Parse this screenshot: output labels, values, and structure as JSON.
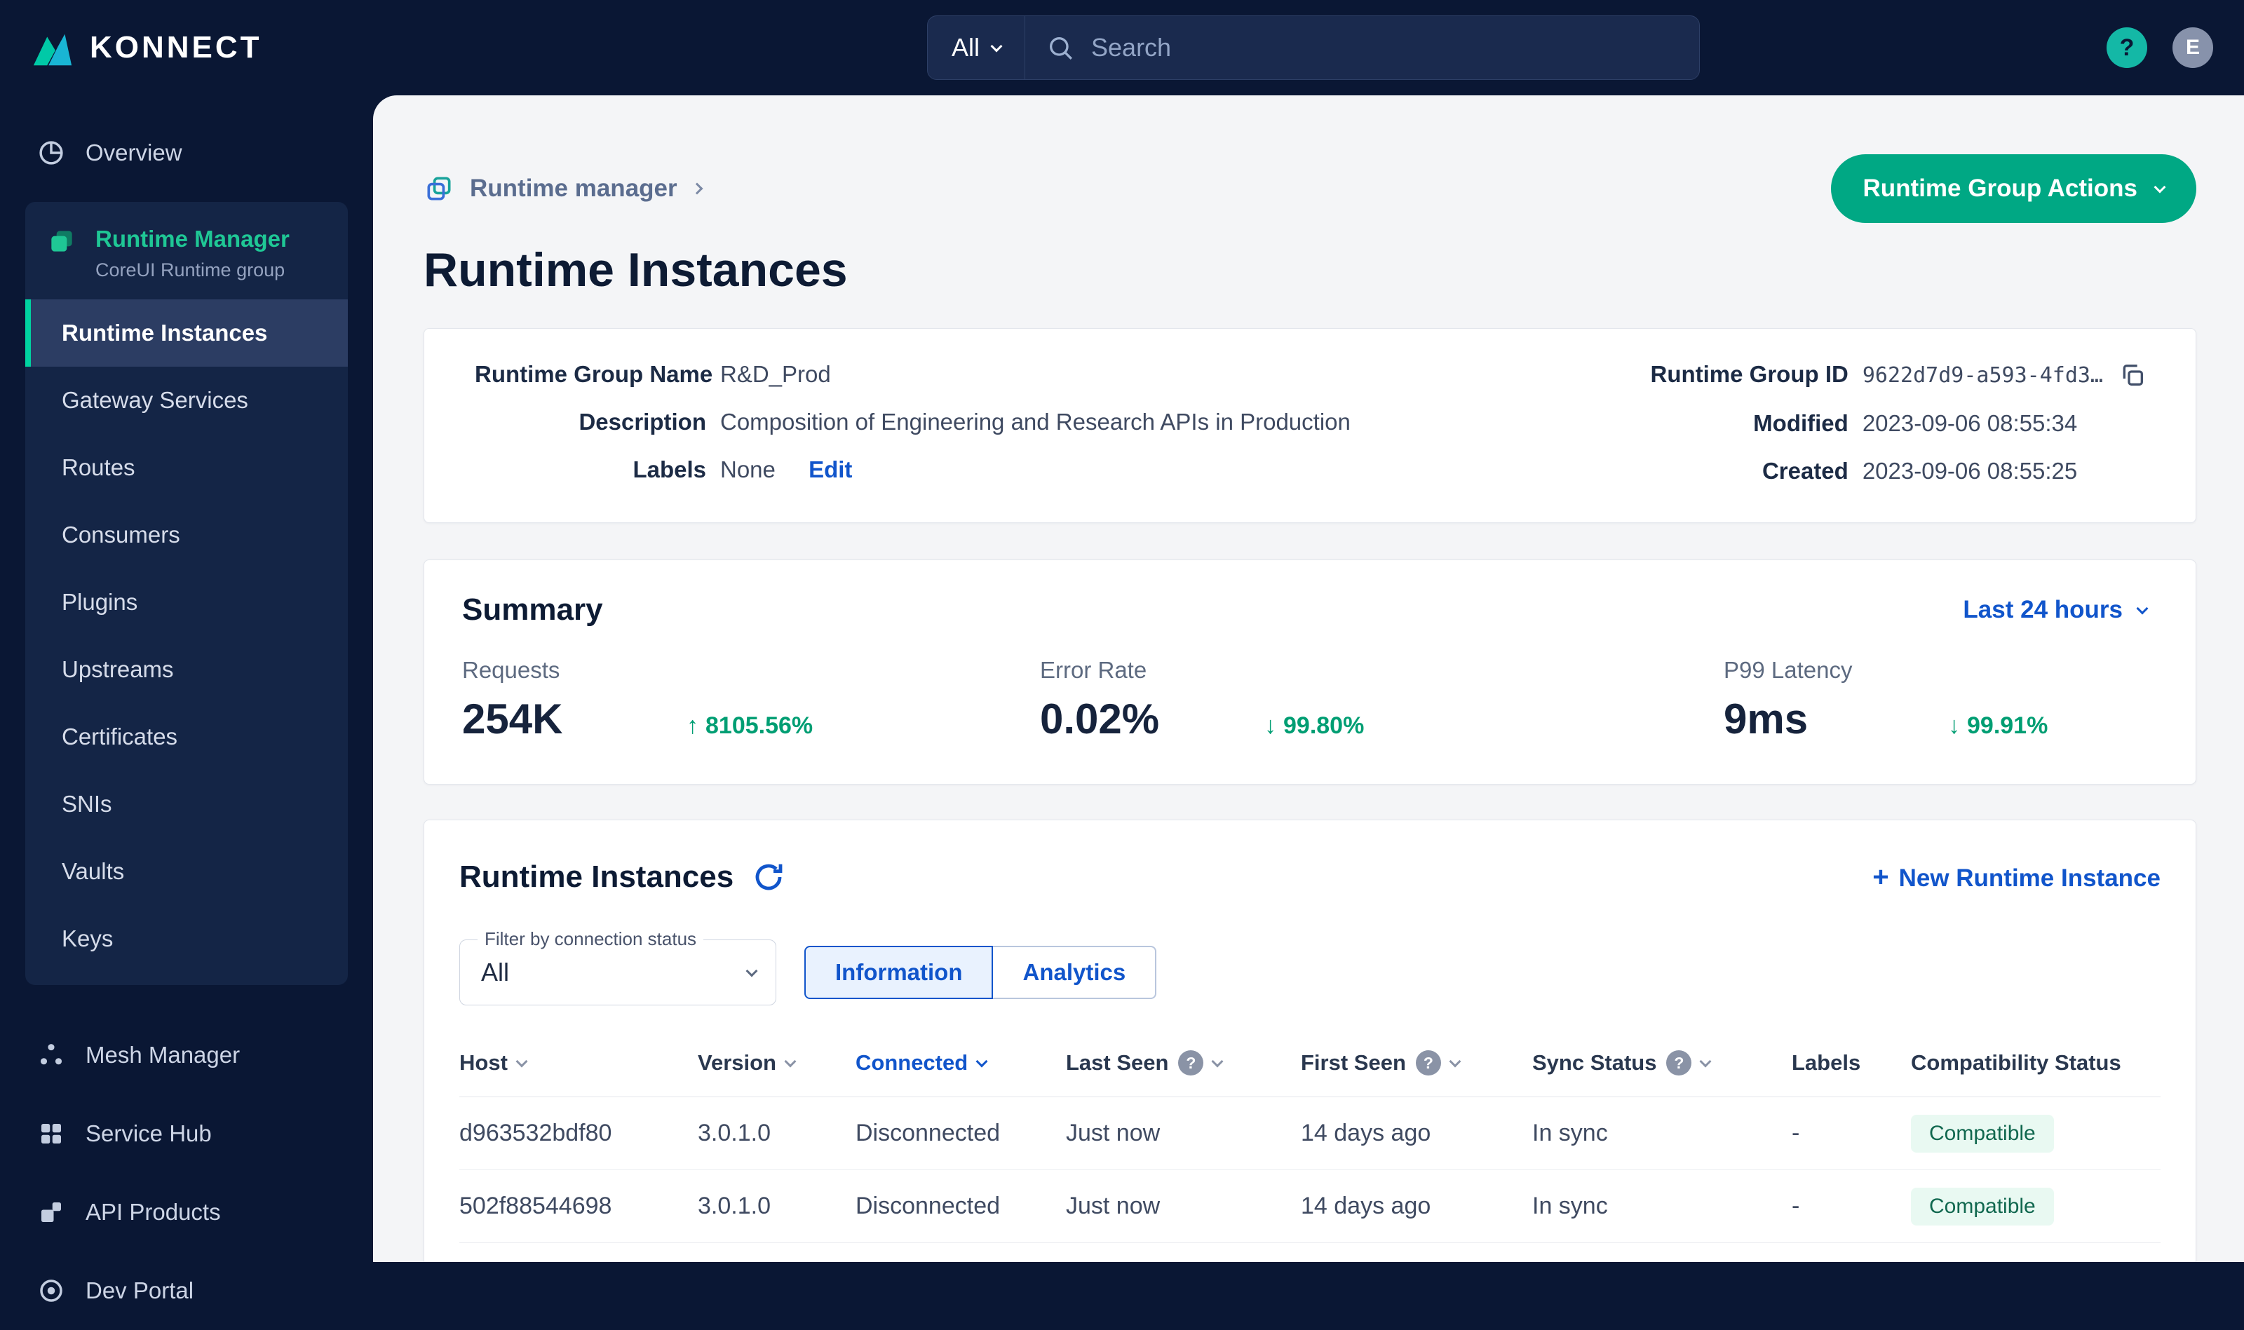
{
  "topbar": {
    "logo": "KONNECT",
    "search": {
      "scope": "All",
      "placeholder": "Search"
    },
    "avatar_initial": "E",
    "help_glyph": "?"
  },
  "sidebar": {
    "overview_label": "Overview",
    "group": {
      "title": "Runtime Manager",
      "subtitle": "CoreUI Runtime group",
      "items": [
        "Runtime Instances",
        "Gateway Services",
        "Routes",
        "Consumers",
        "Plugins",
        "Upstreams",
        "Certificates",
        "SNIs",
        "Vaults",
        "Keys"
      ],
      "active_item": "Runtime Instances"
    },
    "bottom_items": [
      "Mesh Manager",
      "Service Hub",
      "API Products",
      "Dev Portal"
    ]
  },
  "header": {
    "breadcrumb": "Runtime manager",
    "title": "Runtime Instances",
    "actions_button": "Runtime Group Actions"
  },
  "info": {
    "fields_left": [
      {
        "label": "Runtime Group Name",
        "value": "R&D_Prod"
      },
      {
        "label": "Description",
        "value": "Composition of Engineering and Research APIs in Production"
      },
      {
        "label": "Labels",
        "value": "None",
        "action": "Edit"
      }
    ],
    "fields_right": [
      {
        "label": "Runtime Group ID",
        "value": "9622d7d9-a593-4fd3…"
      },
      {
        "label": "Modified",
        "value": "2023-09-06 08:55:34"
      },
      {
        "label": "Created",
        "value": "2023-09-06 08:55:25"
      }
    ]
  },
  "summary": {
    "title": "Summary",
    "timeframe": "Last 24 hours",
    "metrics": [
      {
        "label": "Requests",
        "value": "254K",
        "delta": "8105.56%",
        "direction": "up",
        "arrow": "↑"
      },
      {
        "label": "Error Rate",
        "value": "0.02%",
        "delta": "99.80%",
        "direction": "down",
        "arrow": "↓"
      },
      {
        "label": "P99 Latency",
        "value": "9ms",
        "delta": "99.91%",
        "direction": "down",
        "arrow": "↓"
      }
    ]
  },
  "instances": {
    "title": "Runtime Instances",
    "new_button": "New Runtime Instance",
    "plus_glyph": "+",
    "filter": {
      "label": "Filter by connection status",
      "value": "All"
    },
    "tabs": [
      "Information",
      "Analytics"
    ],
    "active_tab": "Information",
    "table": {
      "headers": [
        "Host",
        "Version",
        "Connected",
        "Last Seen",
        "First Seen",
        "Sync Status",
        "Labels",
        "Compatibility Status"
      ],
      "rows": [
        [
          "d963532bdf80",
          "3.0.1.0",
          "Disconnected",
          "Just now",
          "14 days ago",
          "In sync",
          "-",
          "Compatible"
        ],
        [
          "502f88544698",
          "3.0.1.0",
          "Disconnected",
          "Just now",
          "14 days ago",
          "In sync",
          "-",
          "Compatible"
        ]
      ]
    }
  },
  "colors": {
    "navy_bg": "#0a1734",
    "accent_teal": "#00a884",
    "sidebar_active_teal": "#00d3a0",
    "link_blue": "#1155cb",
    "positive_green": "#009e73",
    "badge_green_bg": "#e9f9f2"
  }
}
